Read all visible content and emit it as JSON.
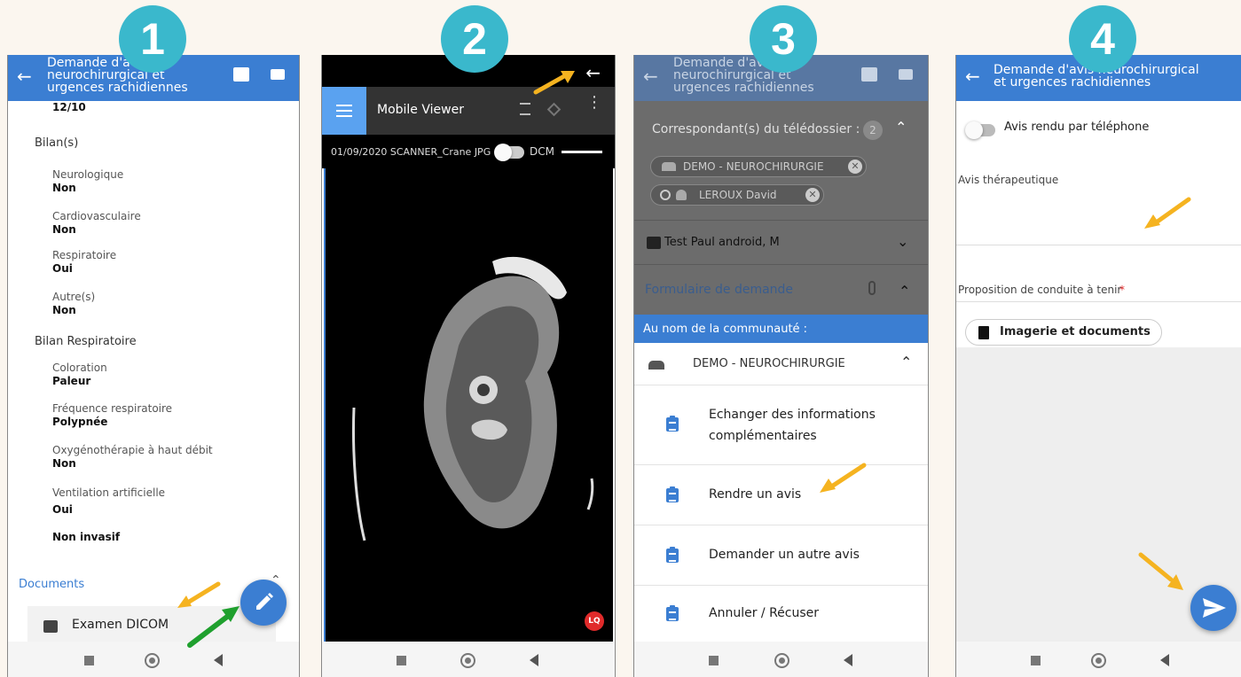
{
  "steps": [
    "1",
    "2",
    "3",
    "4"
  ],
  "colors": {
    "appbar": "#3b7ed2",
    "badge": "#3ab8cc",
    "arrow_orange": "#f5b320",
    "arrow_green": "#1fa02e"
  },
  "phone1": {
    "title": "Demande d'avis neurochirurgical et urgences rachidiennes",
    "top_value": "12/10",
    "section_bilans": "Bilan(s)",
    "fields_a": [
      {
        "label": "Neurologique",
        "value": "Non"
      },
      {
        "label": "Cardiovasculaire",
        "value": "Non"
      },
      {
        "label": "Respiratoire",
        "value": "Oui"
      },
      {
        "label": "Autre(s)",
        "value": "Non"
      }
    ],
    "section_respi": "Bilan Respiratoire",
    "fields_b": [
      {
        "label": "Coloration",
        "value": "Paleur"
      },
      {
        "label": "Fréquence respiratoire",
        "value": "Polypnée"
      },
      {
        "label": "Oxygénothérapie à haut débit",
        "value": "Non"
      },
      {
        "label": "Ventilation artificielle",
        "value": "Oui"
      }
    ],
    "extra_value": "Non invasif",
    "documents_label": "Documents",
    "document_item": "Examen DICOM",
    "icons": [
      "back-arrow-icon",
      "chat-icon",
      "video-icon",
      "edit-pencil-icon",
      "image-icon"
    ]
  },
  "phone2": {
    "viewer_title": "Mobile Viewer",
    "exam_info": "01/09/2020 SCANNER_Crane JPG",
    "format_label": "DCM",
    "quality_badge": "LQ",
    "icons": [
      "back-arrow-icon",
      "menu-icon",
      "align-icon",
      "layers-icon",
      "more-vert-icon"
    ]
  },
  "phone3": {
    "title": "Demande d'avis neurochirurgical et urgences rachidiennes",
    "correspondants_label": "Correspondant(s) du télédossier :",
    "correspondants_count": "2",
    "chips": [
      "DEMO - NEUROCHIRURGIE",
      "LEROUX David"
    ],
    "patient": "Test Paul android, M",
    "form_label": "Formulaire de demande",
    "community_header": "Au nom de la communauté :",
    "community_name": "DEMO - NEUROCHIRURGIE",
    "actions": [
      {
        "line1": "Echanger des informations",
        "line2": "complémentaires"
      },
      {
        "line1": "Rendre un avis",
        "line2": ""
      },
      {
        "line1": "Demander un autre avis",
        "line2": ""
      },
      {
        "line1": "Annuler / Récuser",
        "line2": ""
      }
    ]
  },
  "phone4": {
    "title": "Demande d'avis neurochirurgical et urgences rachidiennes",
    "phone_toggle_label": "Avis rendu par téléphone",
    "therapeutic_label": "Avis thérapeutique",
    "proposal_label": "Proposition de conduite à tenir",
    "required_mark": "*",
    "attach_button": "Imagerie et documents",
    "icons": [
      "back-arrow-icon",
      "add-file-icon",
      "send-icon"
    ]
  }
}
